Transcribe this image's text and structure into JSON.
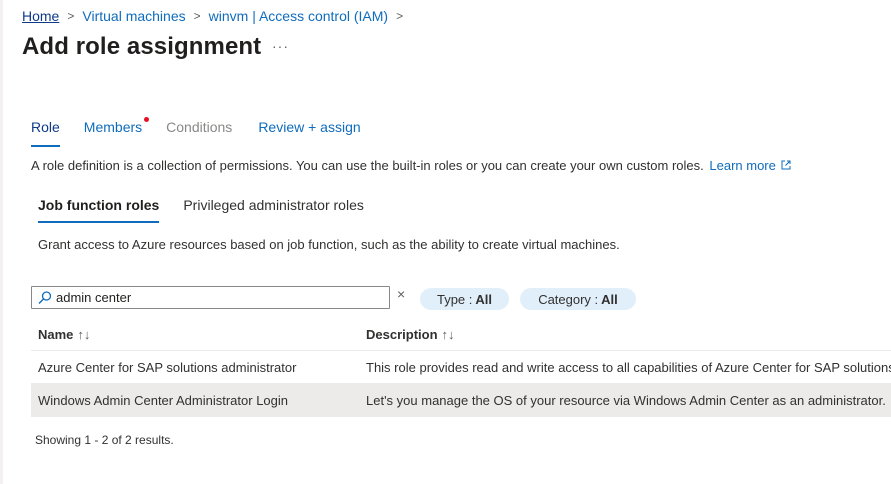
{
  "breadcrumb": [
    {
      "label": "Home"
    },
    {
      "label": "Virtual machines"
    },
    {
      "label": "winvm | Access control (IAM)"
    }
  ],
  "page": {
    "title": "Add role assignment",
    "more_label": "···"
  },
  "tabs": [
    {
      "label": "Role",
      "state": "active"
    },
    {
      "label": "Members",
      "state": "modified"
    },
    {
      "label": "Conditions",
      "state": "disabled"
    },
    {
      "label": "Review + assign",
      "state": "normal"
    }
  ],
  "role_description": {
    "text": "A role definition is a collection of permissions. You can use the built-in roles or you can create your own custom roles.",
    "learn_more": "Learn more",
    "learn_more_icon": "external-link-icon"
  },
  "subtabs": [
    {
      "label": "Job function roles",
      "active": true
    },
    {
      "label": "Privileged administrator roles",
      "active": false
    }
  ],
  "subtab_description": "Grant access to Azure resources based on job function, such as the ability to create virtual machines.",
  "search": {
    "value": "admin center",
    "icon": "search-icon",
    "clear": "×"
  },
  "filters": {
    "type": {
      "label": "Type :",
      "value": "All"
    },
    "category": {
      "label": "Category :",
      "value": "All"
    }
  },
  "table": {
    "columns": [
      {
        "label": "Name",
        "sort": "↑↓"
      },
      {
        "label": "Description",
        "sort": "↑↓"
      }
    ],
    "rows": [
      {
        "name": "Azure Center for SAP solutions administrator",
        "description": "This role provides read and write access to all capabilities of Azure Center for SAP solutions.",
        "selected": false
      },
      {
        "name": "Windows Admin Center Administrator Login",
        "description": "Let's you manage the OS of your resource via Windows Admin Center as an administrator.",
        "selected": true
      }
    ]
  },
  "status": "Showing 1 - 2 of 2 results.",
  "colors": {
    "accent": "#0f6cbd",
    "pill": "#e1effa",
    "selected_row": "#edebe9",
    "dot": "#e81123"
  }
}
